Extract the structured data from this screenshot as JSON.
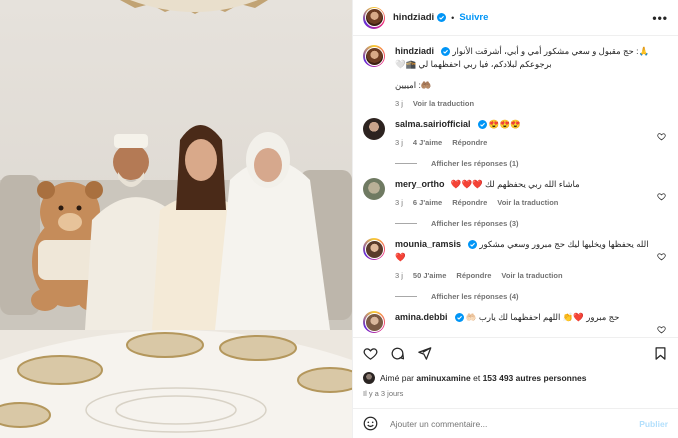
{
  "header": {
    "username": "hindziadi",
    "follow_label": "Suivre",
    "more_label": "•••",
    "dot": "•"
  },
  "caption": {
    "username": "hindziadi",
    "text": "🙏: حج مقبول و سعي مشكور أمي و أبي، أشرقت الأنوار برجوعكم لبلادكم، فيا ربي احفظهما لي 🕋🤍",
    "text2": "🤲🏽: امييين",
    "time": "3 j",
    "translate": "Voir la traduction"
  },
  "comments": [
    {
      "username": "salma.sairiofficial",
      "text": "😍😍😍",
      "time": "3 j",
      "likes": "4 J'aime",
      "reply": "Répondre",
      "replies": "Afficher les réponses (1)",
      "avatar": "av-salma",
      "verified": true,
      "translate": ""
    },
    {
      "username": "mery_ortho",
      "text": "ماشاء الله ربي يحفظهم لك ❤️❤️❤️",
      "time": "3 j",
      "likes": "6 J'aime",
      "reply": "Répondre",
      "translate": "Voir la traduction",
      "replies": "Afficher les réponses (3)",
      "avatar": "av-mery",
      "verified": false
    },
    {
      "username": "mounia_ramsis",
      "text": "الله يحفظها ويخليها ليك حج مبرور وسعي مشكور ❤️",
      "time": "3 j",
      "likes": "50 J'aime",
      "reply": "Répondre",
      "translate": "Voir la traduction",
      "replies": "Afficher les réponses (4)",
      "avatar": "av-mounia",
      "verified": true
    },
    {
      "username": "amina.debbi",
      "text": "حج مبرور ❤️👏 اللهم احفظهما لك يارب 🤲🏻",
      "time": "",
      "likes": "",
      "reply": "",
      "translate": "",
      "replies": "",
      "avatar": "av-amina",
      "verified": true
    }
  ],
  "likes": {
    "prefix": "Aimé par",
    "user": "aminuxamine",
    "suffix": "et",
    "count": "153 493 autres personnes"
  },
  "ago": "Il y a 3 jours",
  "add_comment": {
    "placeholder": "Ajouter un commentaire...",
    "post_label": "Publier"
  },
  "colors": {
    "accent": "#0095f6",
    "like_red": "#ed4956",
    "muted": "#737373"
  },
  "icons": [
    "heart-icon",
    "comment-icon",
    "share-icon",
    "bookmark-icon",
    "emoji-icon",
    "verified-icon",
    "more-icon"
  ]
}
